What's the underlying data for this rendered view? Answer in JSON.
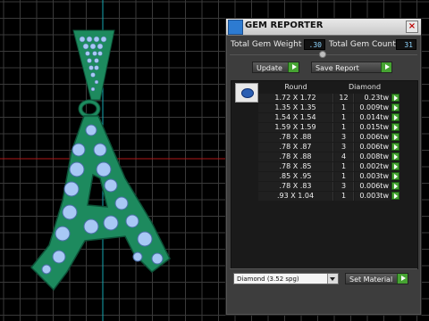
{
  "panel": {
    "title": "GEM REPORTER",
    "total_gem_weight_label": "Total Gem Weight",
    "total_gem_weight_value": ".30",
    "total_gem_count_label": "Total Gem Count",
    "total_gem_count_value": "31",
    "update_label": "Update",
    "save_report_label": "Save Report",
    "table": {
      "headers": [
        "Round",
        "Diamond"
      ],
      "rows": [
        {
          "size": "1.72 X 1.72",
          "count": "12",
          "weight": "0.23tw"
        },
        {
          "size": "1.35 X 1.35",
          "count": "1",
          "weight": "0.009tw"
        },
        {
          "size": "1.54 X 1.54",
          "count": "1",
          "weight": "0.014tw"
        },
        {
          "size": "1.59 X 1.59",
          "count": "1",
          "weight": "0.015tw"
        },
        {
          "size": ".78 X .88",
          "count": "3",
          "weight": "0.006tw"
        },
        {
          "size": ".78 X .87",
          "count": "3",
          "weight": "0.006tw"
        },
        {
          "size": ".78 X .88",
          "count": "4",
          "weight": "0.008tw"
        },
        {
          "size": ".78 X .85",
          "count": "1",
          "weight": "0.002tw"
        },
        {
          "size": ".85 X .95",
          "count": "1",
          "weight": "0.003tw"
        },
        {
          "size": ".78 X .83",
          "count": "3",
          "weight": "0.006tw"
        },
        {
          "size": ".93 X 1.04",
          "count": "1",
          "weight": "0.003tw"
        }
      ]
    },
    "material_select_value": "Diamond     (3.52 spg)",
    "set_material_label": "Set Material"
  },
  "colors": {
    "model_green": "#1d8a5e",
    "model_outline": "#0d5238",
    "gem_blue": "#a8c8f5",
    "grid_line": "#2a2a2a",
    "axis_cyan": "#13a6b0",
    "axis_red": "#b01818",
    "go_green": "#46a332"
  }
}
